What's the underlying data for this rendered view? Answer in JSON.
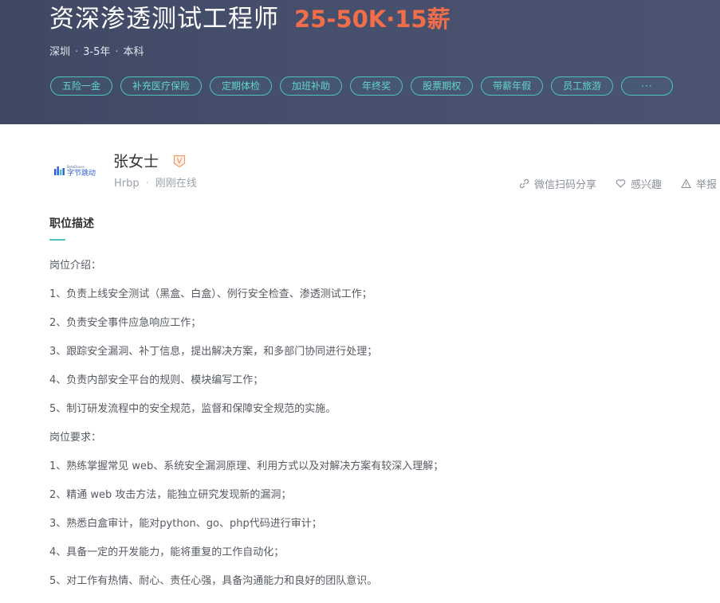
{
  "job": {
    "title": "资深渗透测试工程师",
    "salary": "25-50K·15薪",
    "city": "深圳",
    "experience": "3-5年",
    "education": "本科",
    "separator": "·",
    "benefits": [
      "五险一金",
      "补充医疗保险",
      "定期体检",
      "加班补助",
      "年终奖",
      "股票期权",
      "带薪年假",
      "员工旅游",
      "···"
    ]
  },
  "company": {
    "logo_text": "字节跳动",
    "logo_small_text": "ByteDance",
    "logo_color": "#2f5fd8"
  },
  "contact": {
    "name": "张女士",
    "badge": "V",
    "role": "Hrbp",
    "status": "刚刚在线"
  },
  "actions": {
    "share": "微信扫码分享",
    "interest": "感兴趣",
    "report": "举报"
  },
  "description": {
    "section_title": "职位描述",
    "lines": [
      "岗位介绍：",
      "1、负责上线安全测试（黑盒、白盒）、例行安全检查、渗透测试工作；",
      "2、负责安全事件应急响应工作；",
      "3、跟踪安全漏洞、补丁信息，提出解决方案，和多部门协同进行处理；",
      "4、负责内部安全平台的规则、模块编写工作；",
      "5、制订研发流程中的安全规范，监督和保障安全规范的实施。",
      "岗位要求：",
      "1、熟练掌握常见 web、系统安全漏洞原理、利用方式以及对解决方案有较深入理解；",
      "2、精通 web 攻击方法，能独立研究发现新的漏洞；",
      "3、熟悉白盒审计，能对python、go、php代码进行审计；",
      "4、具备一定的开发能力，能将重复的工作自动化；",
      "5、对工作有热情、耐心、责任心强，具备沟通能力和良好的团队意识。"
    ]
  },
  "colors": {
    "header_bg": "#444d69",
    "salary": "#f26d49",
    "accent": "#4fc2bd"
  }
}
